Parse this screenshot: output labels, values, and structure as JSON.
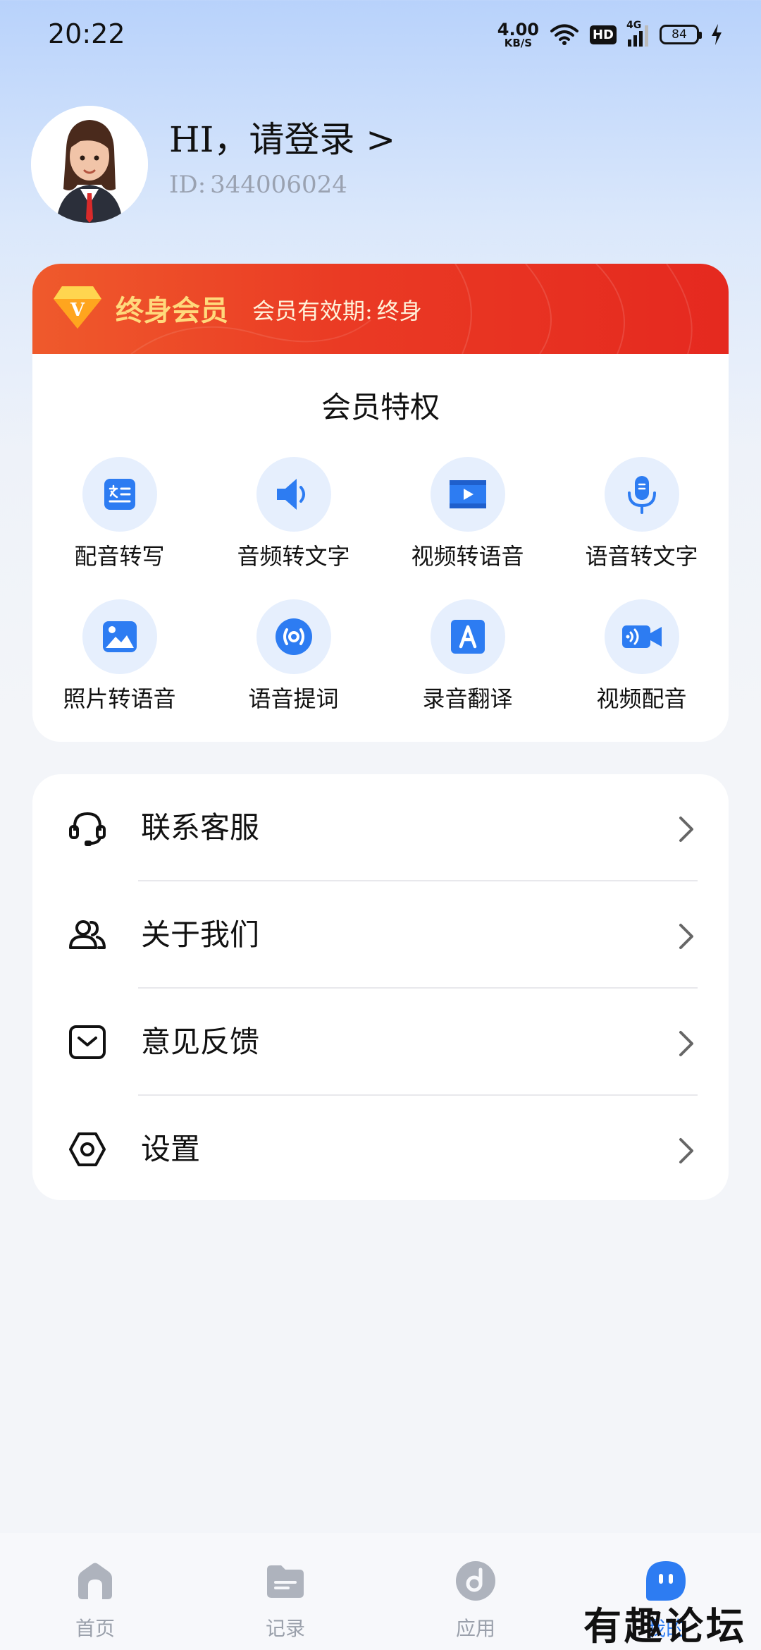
{
  "status": {
    "time": "20:22",
    "net_speed_value": "4.00",
    "net_speed_unit": "KB/S",
    "hd": "HD",
    "network": "4G",
    "battery": "84"
  },
  "profile": {
    "greeting": "HI，请登录 >",
    "id_label": "ID:",
    "id_value": "344006024"
  },
  "membership": {
    "vip_letter": "V",
    "title": "终身会员",
    "validity_label": "会员有效期:",
    "validity_value": "终身",
    "perks_title": "会员特权",
    "perks": [
      {
        "label": "配音转写",
        "icon": "transcribe-icon"
      },
      {
        "label": "音频转文字",
        "icon": "speaker-icon"
      },
      {
        "label": "视频转语音",
        "icon": "video-icon"
      },
      {
        "label": "语音转文字",
        "icon": "microphone-icon"
      },
      {
        "label": "照片转语音",
        "icon": "image-icon"
      },
      {
        "label": "语音提词",
        "icon": "broadcast-icon"
      },
      {
        "label": "录音翻译",
        "icon": "translate-icon"
      },
      {
        "label": "视频配音",
        "icon": "video-camera-icon"
      }
    ]
  },
  "menu": {
    "items": [
      {
        "label": "联系客服",
        "icon": "headset-icon"
      },
      {
        "label": "关于我们",
        "icon": "users-icon"
      },
      {
        "label": "意见反馈",
        "icon": "feedback-icon"
      },
      {
        "label": "设置",
        "icon": "settings-icon"
      }
    ]
  },
  "nav": {
    "items": [
      {
        "label": "首页",
        "icon": "home-icon"
      },
      {
        "label": "记录",
        "icon": "folder-icon"
      },
      {
        "label": "应用",
        "icon": "apps-icon"
      },
      {
        "label": "我的",
        "icon": "profile-icon"
      }
    ],
    "active_index": 3
  },
  "watermark": "有趣论坛",
  "colors": {
    "accent": "#2d7cf2",
    "vip_banner": "#e83a25",
    "vip_gold": "#ffd97c"
  }
}
